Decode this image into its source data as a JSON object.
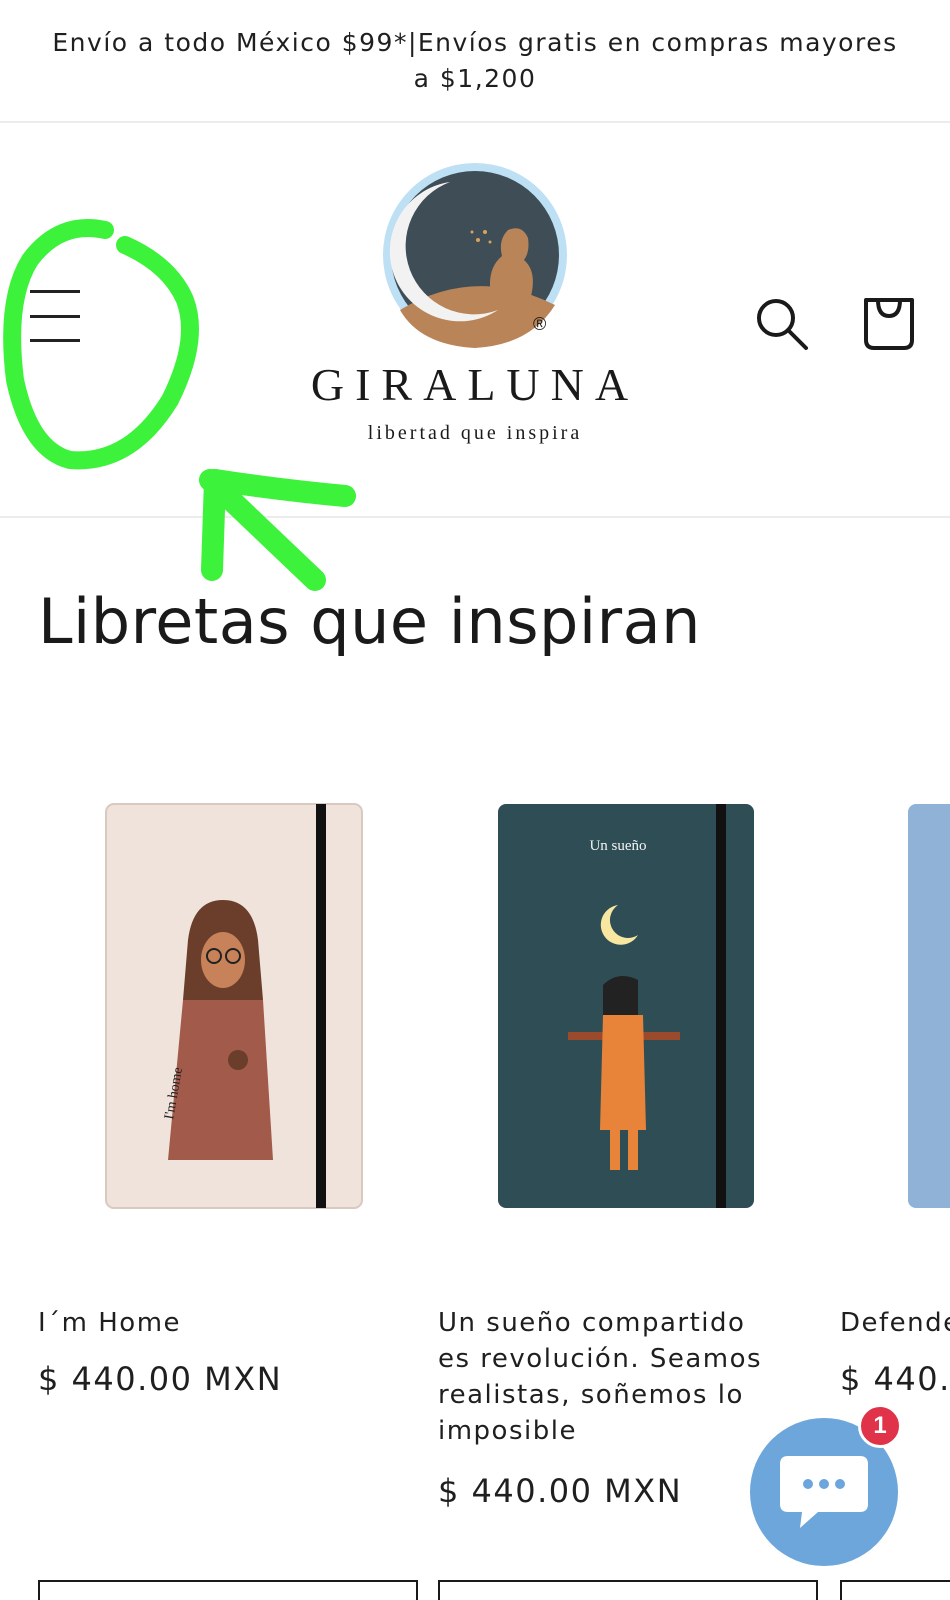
{
  "announcement": {
    "text": "Envío a todo México $99*|Envíos gratis en compras mayores a $1,200"
  },
  "header": {
    "brand_name": "GIRALUNA",
    "brand_tagline": "libertad que inspira",
    "registered_mark": "®",
    "menu_icon": "hamburger-menu-icon",
    "search_icon": "search-icon",
    "cart_icon": "shopping-bag-icon"
  },
  "section": {
    "title": "Libretas que inspiran"
  },
  "products": [
    {
      "title": "I´m Home",
      "price": "$ 440.00 MXN",
      "cover_color": "#efe3dc",
      "cover_text": "I'm home"
    },
    {
      "title": "Un sueño compartido es revolución. Seamos realistas, soñemos lo imposible",
      "price": "$ 440.00 MXN",
      "cover_color": "#2f4d55",
      "cover_text": "Un sueño"
    },
    {
      "title": "Defende",
      "price": "$ 440.",
      "cover_color": "#8fb2d6"
    }
  ],
  "chat": {
    "icon": "chat-bubble-icon",
    "badge_count": "1",
    "accent_color": "#6da6db",
    "badge_color": "#e0334a"
  },
  "annotation": {
    "color": "#3df23a",
    "shapes": "circle-and-arrow"
  }
}
